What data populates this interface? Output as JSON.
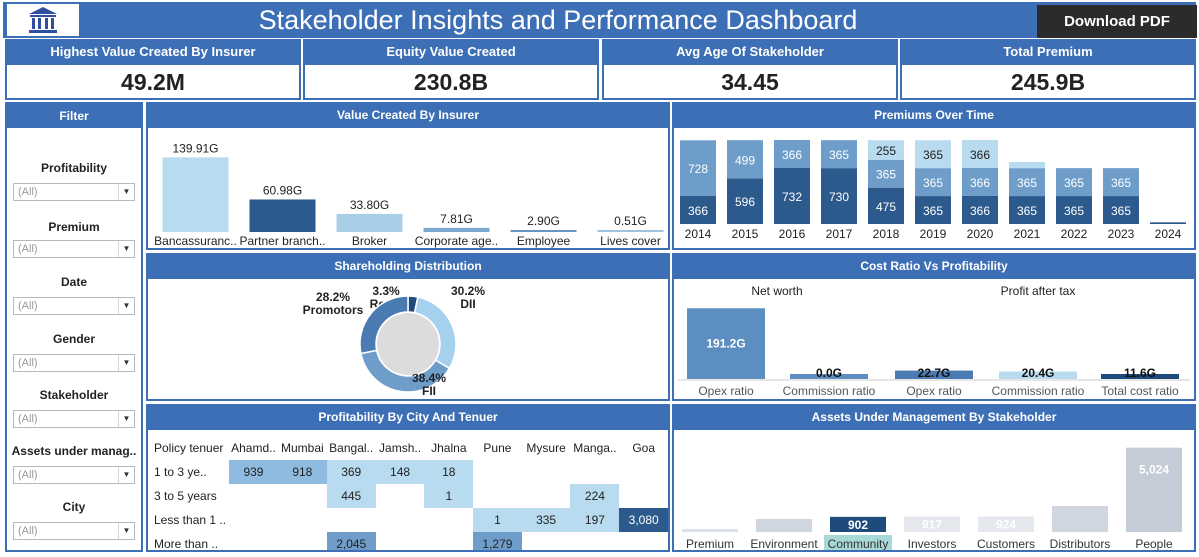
{
  "header": {
    "title": "Stakeholder Insights and Performance Dashboard",
    "download_label": "Download PDF",
    "logo_icon": "bank-building-icon"
  },
  "kpis": [
    {
      "label": "Highest Value Created By Insurer",
      "value": "49.2M"
    },
    {
      "label": "Equity Value Created",
      "value": "230.8B"
    },
    {
      "label": "Avg Age Of Stakeholder",
      "value": "34.45"
    },
    {
      "label": "Total Premium",
      "value": "245.9B"
    }
  ],
  "filters": {
    "title": "Filter",
    "items": [
      {
        "label": "Profitability",
        "value": "(All)"
      },
      {
        "label": "Premium",
        "value": "(All)"
      },
      {
        "label": "Date",
        "value": "(All)"
      },
      {
        "label": "Gender",
        "value": "(All)"
      },
      {
        "label": "Stakeholder",
        "value": "(All)"
      },
      {
        "label": "Assets under manag..",
        "value": "(All)"
      },
      {
        "label": "City",
        "value": "(All)"
      }
    ]
  },
  "panels": {
    "value_created": "Value Created By Insurer",
    "premiums": "Premiums Over Time",
    "shareholding": "Shareholding Distribution",
    "cost_ratio": "Cost Ratio Vs Profitability",
    "profitability_city": "Profitability By City And Tenuer",
    "aum": "Assets Under Management By Stakeholder"
  },
  "chart_data": [
    {
      "id": "value_created",
      "type": "bar",
      "categories": [
        "Bancassuranc..",
        "Partner branch..",
        "Broker",
        "Corporate age..",
        "Employee",
        "Lives cover"
      ],
      "values": [
        139.91,
        60.98,
        33.8,
        7.81,
        2.9,
        0.51
      ],
      "labels": [
        "139.91G",
        "60.98G",
        "33.80G",
        "7.81G",
        "2.90G",
        "0.51G"
      ],
      "colors": [
        "#b8dcef",
        "#2c5a8c",
        "#a9cfe8",
        "#7ba8cf",
        "#6896c4",
        "#9ec3e0"
      ],
      "ylim": [
        0,
        150
      ]
    },
    {
      "id": "premiums_over_time",
      "type": "bar",
      "stacked": true,
      "categories": [
        "2014",
        "2015",
        "2016",
        "2017",
        "2018",
        "2019",
        "2020",
        "2021",
        "2022",
        "2023",
        "2024"
      ],
      "series": [
        {
          "values": [
            366,
            596,
            732,
            730,
            475,
            365,
            366,
            365,
            365,
            365,
            22
          ],
          "labels": [
            "366",
            "596",
            "732",
            "730",
            "475",
            "365",
            "366",
            "365",
            "365",
            "365",
            ""
          ],
          "color": "#2c5a8c"
        },
        {
          "values": [
            728,
            499,
            366,
            365,
            365,
            365,
            366,
            365,
            365,
            365,
            0
          ],
          "labels": [
            "728",
            "499",
            "366",
            "365",
            "365",
            "365",
            "366",
            "365",
            "365",
            "365",
            ""
          ],
          "color": "#6f9dc9"
        },
        {
          "values": [
            0,
            0,
            0,
            0,
            255,
            365,
            366,
            80,
            0,
            0,
            0
          ],
          "labels": [
            "",
            "",
            "",
            "",
            "255",
            "365",
            "366",
            "",
            "",
            "",
            ""
          ],
          "color": "#b9dbef"
        }
      ],
      "ylim": [
        0,
        1150
      ]
    },
    {
      "id": "shareholding",
      "type": "pie",
      "donut": true,
      "slices": [
        {
          "name": "Retail",
          "label": "3.3%",
          "value": 3.3,
          "color": "#1f4a7c"
        },
        {
          "name": "DII",
          "label": "30.2%",
          "value": 30.2,
          "color": "#a6d1ee"
        },
        {
          "name": "FII",
          "label": "38.4%",
          "value": 38.4,
          "color": "#6f9dc9"
        },
        {
          "name": "Promotors",
          "label": "28.2%",
          "value": 28.2,
          "color": "#4a7bb3"
        }
      ]
    },
    {
      "id": "cost_ratio",
      "type": "bar",
      "groups": [
        {
          "name": "Net worth",
          "bars": [
            {
              "category": "Opex ratio",
              "value": 191.2,
              "label": "191.2G",
              "color": "#5d8ec0"
            },
            {
              "category": "Commission ratio",
              "value": 0.0,
              "label": "0.0G",
              "color": "#5d8ec0"
            }
          ]
        },
        {
          "name": "Profit after tax",
          "bars": [
            {
              "category": "Opex ratio",
              "value": 22.7,
              "label": "22.7G",
              "color": "#4a7bb3"
            },
            {
              "category": "Commission ratio",
              "value": 20.4,
              "label": "20.4G",
              "color": "#b9dbef"
            },
            {
              "category": "Total cost ratio",
              "value": 11.6,
              "label": "11.6G",
              "color": "#1f4a7c"
            }
          ]
        }
      ],
      "ylim": [
        0,
        200
      ]
    },
    {
      "id": "profitability_city",
      "type": "heatmap",
      "row_header": "Policy tenuer",
      "columns": [
        "Ahamd..",
        "Mumbai",
        "Bangal..",
        "Jamsh..",
        "Jhalna",
        "Pune",
        "Mysure",
        "Manga..",
        "Goa"
      ],
      "rows": [
        {
          "label": "1 to 3 ye..",
          "cells": [
            "939",
            "918",
            "369",
            "148",
            "18",
            "",
            "",
            "",
            ""
          ]
        },
        {
          "label": "3 to 5 years",
          "cells": [
            "",
            "",
            "445",
            "",
            "1",
            "",
            "",
            "224",
            ""
          ]
        },
        {
          "label": "Less than 1 ..",
          "cells": [
            "",
            "",
            "",
            "",
            "",
            "1",
            "335",
            "197",
            "3,080"
          ]
        },
        {
          "label": "More than ..",
          "cells": [
            "",
            "",
            "2,045",
            "",
            "",
            "1,279",
            "",
            "",
            ""
          ]
        }
      ]
    },
    {
      "id": "aum",
      "type": "bar",
      "categories": [
        "Premium",
        "Environment",
        "Community",
        "Investors",
        "Customers",
        "Distributors",
        "People"
      ],
      "values": [
        0,
        0,
        902,
        917,
        924,
        0,
        5024
      ],
      "labels": [
        "",
        "",
        "902",
        "917",
        "924",
        "",
        "5,024"
      ],
      "colors": [
        "#dde2ea",
        "#cfd6df",
        "#1f4a7c",
        "#e4e7ec",
        "#e4e7ec",
        "#cfd6df",
        "#c4ccd7"
      ],
      "highlight": "Community",
      "ylim": [
        0,
        5600
      ]
    }
  ]
}
